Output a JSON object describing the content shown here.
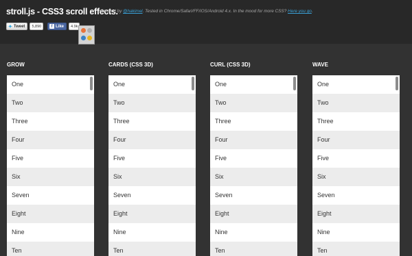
{
  "header": {
    "title": "stroll.js - CSS3 scroll effects.",
    "credits_prefix": "Created by ",
    "credits_author": "@hakimel",
    "credits_middle": ". Tested in Chrome/Safari/FF/iOS/Android 4.x. In the mood for more CSS? ",
    "credits_link": "Here you go",
    "credits_suffix": "."
  },
  "share": {
    "tweet_label": "Tweet",
    "tweet_count": "5,890",
    "like_label": "Like",
    "like_count": "4.9k"
  },
  "colors": {
    "background": "#323232",
    "header_bg": "#282828",
    "link": "#3aa2d9",
    "row_alt": "#ececec"
  },
  "lists": [
    {
      "heading": "GROW",
      "items": [
        "One",
        "Two",
        "Three",
        "Four",
        "Five",
        "Six",
        "Seven",
        "Eight",
        "Nine",
        "Ten"
      ]
    },
    {
      "heading": "CARDS (CSS 3D)",
      "items": [
        "One",
        "Two",
        "Three",
        "Four",
        "Five",
        "Six",
        "Seven",
        "Eight",
        "Nine",
        "Ten"
      ]
    },
    {
      "heading": "CURL (CSS 3D)",
      "items": [
        "One",
        "Two",
        "Three",
        "Four",
        "Five",
        "Six",
        "Seven",
        "Eight",
        "Nine",
        "Ten"
      ]
    },
    {
      "heading": "WAVE",
      "items": [
        "One",
        "Two",
        "Three",
        "Four",
        "Five",
        "Six",
        "Seven",
        "Eight",
        "Nine",
        "Ten"
      ]
    }
  ]
}
